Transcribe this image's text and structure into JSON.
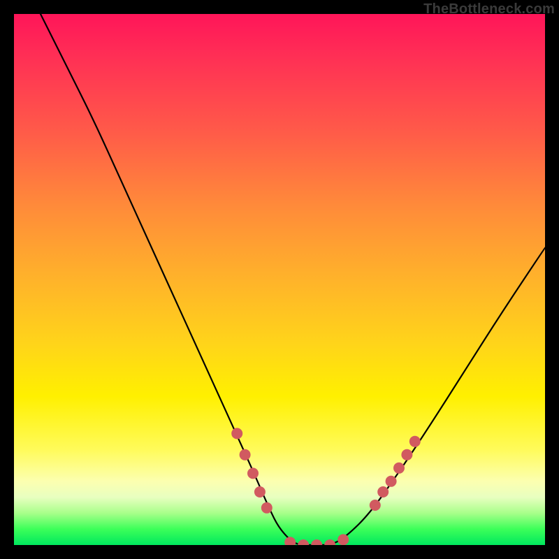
{
  "watermark": {
    "text": "TheBottleneck.com"
  },
  "chart_data": {
    "type": "line",
    "title": "",
    "xlabel": "",
    "ylabel": "",
    "xlim": [
      0,
      100
    ],
    "ylim": [
      0,
      100
    ],
    "grid": false,
    "legend": false,
    "series": [
      {
        "name": "bottleneck-curve",
        "x": [
          5,
          10,
          15,
          20,
          25,
          30,
          35,
          40,
          45,
          48,
          50,
          53,
          56,
          60,
          63,
          67,
          72,
          78,
          85,
          92,
          100
        ],
        "y": [
          100,
          90,
          80,
          69,
          58,
          47,
          36,
          25,
          14,
          7,
          3,
          0,
          0,
          0,
          2,
          6,
          13,
          22,
          33,
          44,
          56
        ]
      }
    ],
    "highlight_points": {
      "name": "highlight-dots",
      "color": "#d15a60",
      "points": [
        {
          "x": 42,
          "y": 21
        },
        {
          "x": 43.5,
          "y": 17
        },
        {
          "x": 45,
          "y": 13.5
        },
        {
          "x": 46.3,
          "y": 10
        },
        {
          "x": 47.6,
          "y": 7
        },
        {
          "x": 52,
          "y": 0.5
        },
        {
          "x": 54.5,
          "y": 0
        },
        {
          "x": 57,
          "y": 0
        },
        {
          "x": 59.5,
          "y": 0
        },
        {
          "x": 62,
          "y": 1
        },
        {
          "x": 68,
          "y": 7.5
        },
        {
          "x": 69.5,
          "y": 10
        },
        {
          "x": 71,
          "y": 12
        },
        {
          "x": 72.5,
          "y": 14.5
        },
        {
          "x": 74,
          "y": 17
        },
        {
          "x": 75.5,
          "y": 19.5
        }
      ]
    },
    "background_gradient": {
      "stops": [
        {
          "pos": 0,
          "color": "#ff1559"
        },
        {
          "pos": 50,
          "color": "#ffb32a"
        },
        {
          "pos": 82,
          "color": "#fffb5a"
        },
        {
          "pos": 97,
          "color": "#3cff59"
        },
        {
          "pos": 100,
          "color": "#00e85e"
        }
      ]
    }
  }
}
